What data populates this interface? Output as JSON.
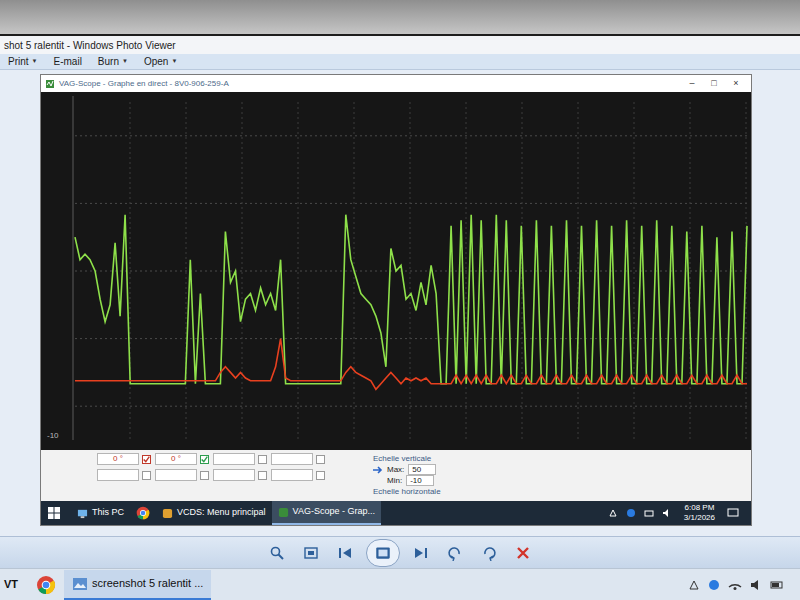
{
  "photo_viewer": {
    "title": "shot 5 ralentit - Windows Photo Viewer",
    "menu": [
      {
        "label": "Print",
        "arrow": "▼"
      },
      {
        "label": "E-mail"
      },
      {
        "label": "Burn",
        "arrow": "▼"
      },
      {
        "label": "Open",
        "arrow": "▼"
      }
    ]
  },
  "scope_window": {
    "title": "VAG-Scope - Graphe en direct - 8V0-906-259-A",
    "controls": [
      "–",
      "□",
      "×"
    ]
  },
  "chart": {
    "y_min_label": "-10",
    "y_min": -10,
    "y_max": 50,
    "series": [
      {
        "color": "#8ee04a",
        "values": [
          26,
          22,
          23,
          22,
          20,
          15,
          11,
          14,
          25,
          12,
          30,
          0,
          0,
          0,
          0,
          0,
          0,
          0,
          0,
          0,
          0,
          0,
          0,
          22,
          0,
          16,
          0,
          0,
          0,
          0,
          27,
          18,
          20,
          11,
          15,
          16,
          13,
          17,
          14,
          16,
          13,
          22,
          0,
          0,
          0,
          0,
          0,
          0,
          0,
          0,
          0,
          0,
          0,
          0,
          30,
          22,
          19,
          16,
          15,
          14,
          12,
          9,
          3,
          24,
          20,
          21,
          15,
          16,
          13,
          18,
          14,
          21,
          16,
          0,
          0,
          28,
          0,
          29,
          0,
          30,
          0,
          29,
          0,
          0,
          30,
          0,
          29,
          0,
          0,
          28,
          0,
          0,
          29,
          0,
          0,
          28,
          0,
          0,
          29,
          0,
          0,
          28,
          0,
          0,
          29,
          0,
          0,
          28,
          0,
          0,
          29,
          0,
          0,
          28,
          0,
          0,
          29,
          0,
          0,
          28,
          0,
          0,
          27,
          0,
          0,
          28,
          0,
          0,
          26,
          0,
          0,
          27,
          0,
          0,
          28
        ]
      },
      {
        "color": "#e8401f",
        "values": [
          0.5,
          0.5,
          0.5,
          0.5,
          0.5,
          0.5,
          0.5,
          0.5,
          0.5,
          0.5,
          0.5,
          0.5,
          0.5,
          0.5,
          0.5,
          0.5,
          0.5,
          0.5,
          0.5,
          0.5,
          0.5,
          0.5,
          0.5,
          0.5,
          0.5,
          0.5,
          0.5,
          0.5,
          0.5,
          2,
          3,
          2,
          1,
          2,
          1,
          0.5,
          0.5,
          0.5,
          0.5,
          0.5,
          3,
          8,
          1,
          0.5,
          0.5,
          0.5,
          0.5,
          0.5,
          0.5,
          0.5,
          0.5,
          0.5,
          0.5,
          0.5,
          2,
          3,
          2,
          1.5,
          1,
          0.5,
          -1,
          0,
          1,
          2,
          1,
          0,
          1,
          0.5,
          1,
          0.5,
          1,
          0,
          0,
          0,
          0,
          0,
          1.5,
          0,
          1.5,
          0,
          1.5,
          0,
          1.5,
          0,
          0,
          1.5,
          0,
          1.5,
          0,
          0,
          1.5,
          0,
          0,
          1.5,
          0,
          0,
          1.5,
          0,
          0,
          1.5,
          0,
          0,
          1.5,
          0,
          0,
          1.5,
          0,
          0,
          1.5,
          0,
          0,
          1.5,
          0,
          0,
          1.5,
          0,
          0,
          1.5,
          0,
          0,
          1.5,
          0,
          0,
          1.5,
          0,
          0,
          1.5,
          0,
          0,
          1.5,
          0,
          0,
          1.5,
          0,
          0
        ]
      }
    ]
  },
  "channels": [
    {
      "value": "0 °",
      "checked": true,
      "color": "#c0392b"
    },
    {
      "value": "0 °",
      "checked": true,
      "color": "#2e9e4f"
    },
    {
      "value": "",
      "checked": false,
      "color": "#999999"
    },
    {
      "value": "",
      "checked": false,
      "color": "#999999"
    },
    {
      "value": "",
      "checked": false,
      "color": "#999999"
    },
    {
      "value": "",
      "checked": false,
      "color": "#999999"
    },
    {
      "value": "",
      "checked": false,
      "color": "#999999"
    },
    {
      "value": "",
      "checked": false,
      "color": "#999999"
    }
  ],
  "vertical_scale": {
    "label": "Echelle verticale",
    "max_label": "Max:",
    "max": "50",
    "min_label": "Min:",
    "min": "-10"
  },
  "horizontal_scale": {
    "label": "Echelle horizontale"
  },
  "inner_taskbar": {
    "items": [
      {
        "label": "This PC",
        "selected": false
      },
      {
        "label": "VCDS: Menu principal",
        "selected": false
      },
      {
        "label": "VAG-Scope - Grap...",
        "selected": true
      }
    ],
    "time": "6:08 PM",
    "date": "3/1/2026"
  },
  "outer_taskbar": {
    "start": "VT",
    "items": [
      {
        "label": "screenshot 5 ralentit ...",
        "selected": true
      }
    ]
  }
}
